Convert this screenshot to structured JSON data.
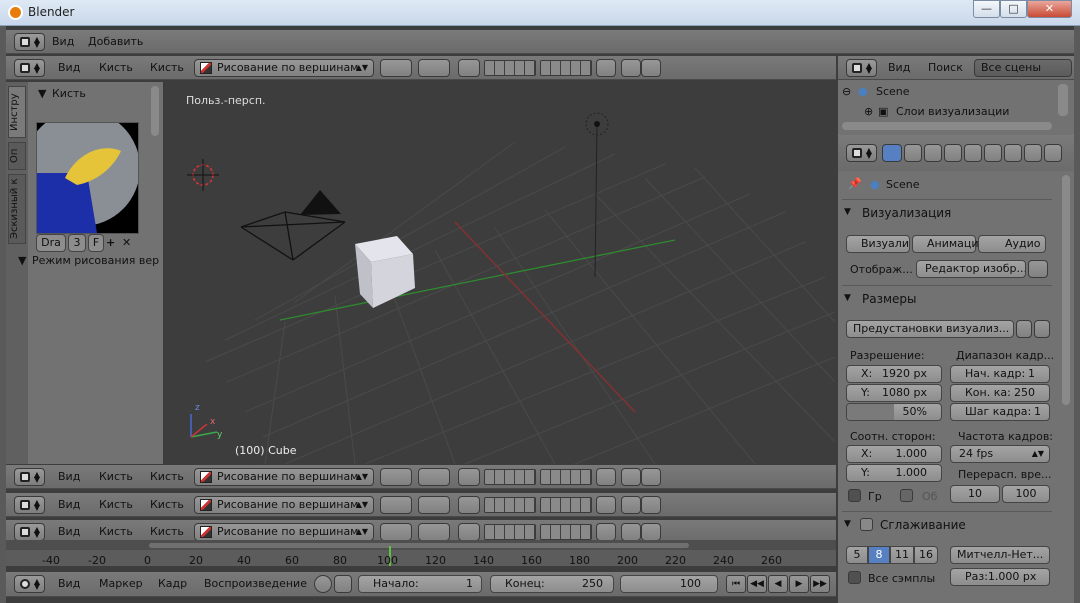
{
  "window": {
    "title": "Blender",
    "minimize": "—",
    "maximize": "□",
    "close": "✕"
  },
  "info_header": {
    "menu": [
      "Вид",
      "Добавить"
    ]
  },
  "view3d_header": {
    "menu": [
      "Вид",
      "Кисть",
      "Кисть"
    ],
    "mode": "Рисование по вершинам"
  },
  "outliner": {
    "menu": [
      "Вид",
      "Поиск"
    ],
    "scope": "Все сцены",
    "items": [
      "Scene",
      "Слои визуализации"
    ]
  },
  "toolshelf": {
    "tabs": [
      "Инстру",
      "Оп",
      "Эскизный к"
    ],
    "brush_panel": "Кисть",
    "brush_name": "Dra",
    "brush_users": "3",
    "brush_fake": "F",
    "paint_mode_panel": "Режим рисования вер"
  },
  "viewport": {
    "view_label": "Польз.-персп.",
    "object_label": "(100) Cube",
    "axis_x": "x",
    "axis_y": "y",
    "axis_z": "z"
  },
  "extra_headers": [
    {
      "menu": [
        "Вид",
        "Кисть",
        "Кисть"
      ],
      "mode": "Рисование по вершинам"
    },
    {
      "menu": [
        "Вид",
        "Кисть",
        "Кисть"
      ],
      "mode": "Рисование по вершинам"
    },
    {
      "menu": [
        "Вид",
        "Кисть",
        "Кисть"
      ],
      "mode": "Рисование по вершинам"
    }
  ],
  "properties": {
    "scene": "Scene",
    "render_section": "Визуализация",
    "render_buttons": [
      "Визуали",
      "Анимаци",
      "Аудио"
    ],
    "display_label": "Отображ...",
    "display_value": "Редактор изобр...",
    "dimensions_section": "Размеры",
    "presets": "Предустановки визуализ...",
    "resolution_label": "Разрешение:",
    "res_x_label": "X:",
    "res_x": "1920 px",
    "res_y_label": "Y:",
    "res_y": "1080 px",
    "res_pct": "50%",
    "frame_range_label": "Диапазон кадр...",
    "start_label": "Нач. кадр:",
    "start": "1",
    "end_label": "Кон. ка:",
    "end": "250",
    "step_label": "Шаг кадра:",
    "step": "1",
    "aspect_label": "Соотн. сторон:",
    "asp_x_label": "X:",
    "asp_x": "1.000",
    "asp_y_label": "Y:",
    "asp_y": "1.000",
    "fps_label": "Частота кадров:",
    "fps": "24 fps",
    "border_label": "Гр",
    "crop_label": "Об",
    "remap_label": "Перерасп. вре...",
    "remap_old": "10",
    "remap_new": "100",
    "aa_section": "Сглаживание",
    "aa_samples": [
      "5",
      "8",
      "11",
      "16"
    ],
    "aa_selected": "8",
    "aa_filter": "Митчелл-Нет...",
    "full_sample": "Все сэмплы",
    "filter_size": "Раз:1.000 px"
  },
  "timeline": {
    "ticks": [
      "-40",
      "-20",
      "0",
      "20",
      "40",
      "60",
      "80",
      "100",
      "120",
      "140",
      "160",
      "180",
      "200",
      "220",
      "240",
      "260"
    ],
    "current_frame": 100,
    "menu": [
      "Вид",
      "Маркер",
      "Кадр",
      "Воспроизведение"
    ],
    "start_label": "Начало:",
    "start": "1",
    "end_label": "Конец:",
    "end": "250",
    "current": "100"
  }
}
